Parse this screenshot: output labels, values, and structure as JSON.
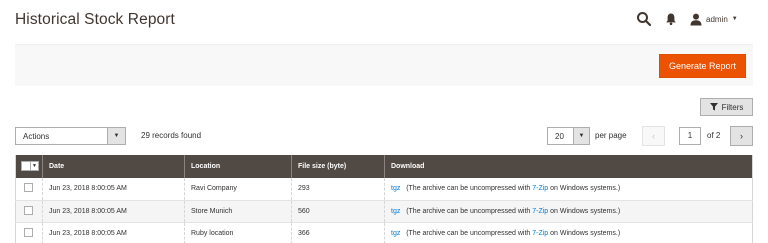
{
  "header": {
    "title": "Historical Stock Report",
    "user_name": "admin",
    "icons": {
      "search": "search-icon",
      "notifications": "bell-icon",
      "user": "user-icon"
    }
  },
  "action_bar": {
    "generate_label": "Generate Report"
  },
  "toolbar": {
    "filters_label": "Filters",
    "actions_label": "Actions",
    "records_label": "29 records found",
    "per_page_value": "20",
    "per_page_label": "per page",
    "page_value": "1",
    "page_of": "of 2",
    "prev_symbol": "‹",
    "next_symbol": "›"
  },
  "grid": {
    "columns": [
      "Date",
      "Location",
      "File size (byte)",
      "Download"
    ],
    "rows": [
      {
        "date": "Jun 23, 2018 8:00:05 AM",
        "location": "Ravi Company",
        "size": "293",
        "link": "tgz",
        "note_pre": "(The archive can be uncompressed with ",
        "note_link": "7-Zip",
        "note_post": " on Windows systems.)"
      },
      {
        "date": "Jun 23, 2018 8:00:05 AM",
        "location": "Store Munich",
        "size": "560",
        "link": "tgz",
        "note_pre": "(The archive can be uncompressed with ",
        "note_link": "7-Zip",
        "note_post": " on Windows systems.)"
      },
      {
        "date": "Jun 23, 2018 8:00:05 AM",
        "location": "Ruby location",
        "size": "366",
        "link": "tgz",
        "note_pre": "(The archive can be uncompressed with ",
        "note_link": "7-Zip",
        "note_post": " on Windows systems.)"
      }
    ]
  },
  "colors": {
    "accent": "#eb5202",
    "grid_header": "#514943",
    "link": "#007bdb"
  }
}
